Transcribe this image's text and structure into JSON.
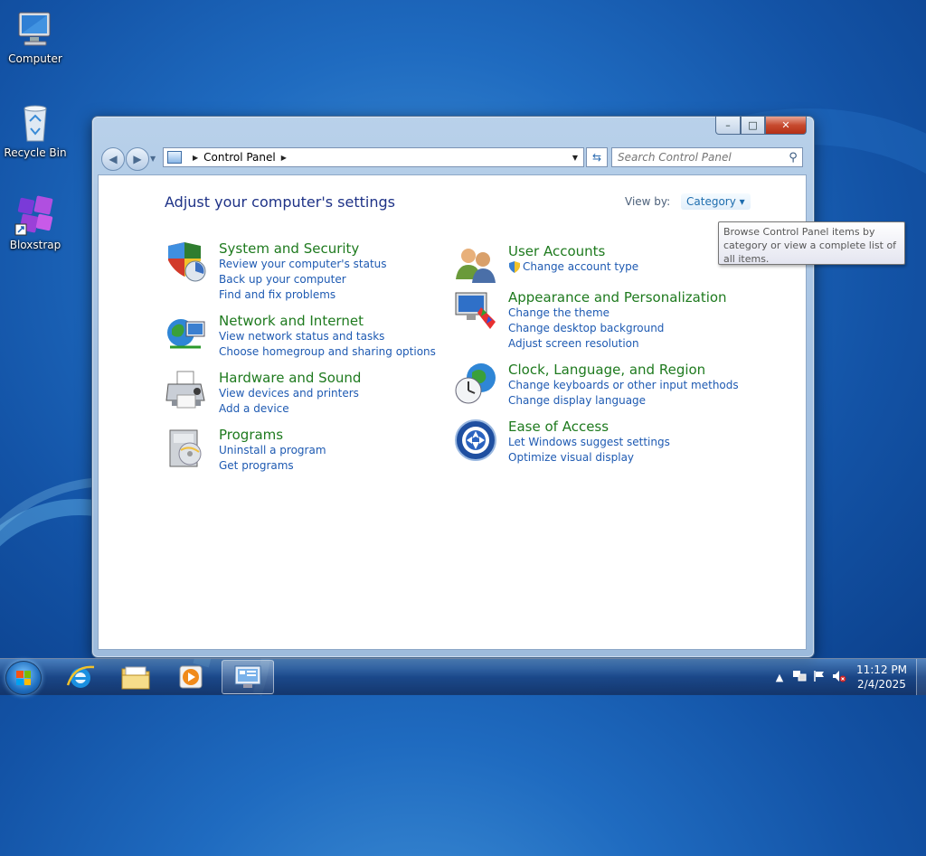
{
  "desktop": {
    "icons": [
      {
        "label": "Computer",
        "icon": "computer-icon"
      },
      {
        "label": "Recycle Bin",
        "icon": "recycle-bin-icon"
      },
      {
        "label": "Bloxstrap",
        "icon": "bloxstrap-icon"
      }
    ]
  },
  "window": {
    "address_root": "Control Panel",
    "search_placeholder": "Search Control Panel",
    "caption": {
      "minimize": "–",
      "maximize": "□",
      "close": "✕"
    }
  },
  "content": {
    "heading": "Adjust your computer's settings",
    "view_by_label": "View by:",
    "view_by_value": "Category",
    "categories": [
      {
        "title": "System and Security",
        "icon": "shield-icon",
        "links": [
          "Review your computer's status",
          "Back up your computer",
          "Find and fix problems"
        ]
      },
      {
        "title": "Network and Internet",
        "icon": "network-globe-icon",
        "links": [
          "View network status and tasks",
          "Choose homegroup and sharing options"
        ]
      },
      {
        "title": "Hardware and Sound",
        "icon": "printer-icon",
        "links": [
          "View devices and printers",
          "Add a device"
        ]
      },
      {
        "title": "Programs",
        "icon": "programs-icon",
        "links": [
          "Uninstall a program",
          "Get programs"
        ]
      },
      {
        "title": "User Accounts",
        "icon": "users-icon",
        "links": [
          "Change account type"
        ]
      },
      {
        "title": "Appearance and Personalization",
        "icon": "monitor-palette-icon",
        "links": [
          "Change the theme",
          "Change desktop background",
          "Adjust screen resolution"
        ]
      },
      {
        "title": "Clock, Language, and Region",
        "icon": "clock-globe-icon",
        "links": [
          "Change keyboards or other input methods",
          "Change display language"
        ]
      },
      {
        "title": "Ease of Access",
        "icon": "ease-of-access-icon",
        "links": [
          "Let Windows suggest settings",
          "Optimize visual display"
        ]
      }
    ]
  },
  "tooltip": "Browse Control Panel items by category or view a complete list of all items.",
  "taskbar": {
    "apps": [
      "internet-explorer-icon",
      "file-explorer-icon",
      "media-player-icon",
      "control-panel-icon"
    ],
    "time": "11:12 PM",
    "date": "2/4/2025"
  },
  "colors": {
    "category_title": "#1e7a1e",
    "link": "#1e5ab2",
    "heading": "#1e3287"
  }
}
